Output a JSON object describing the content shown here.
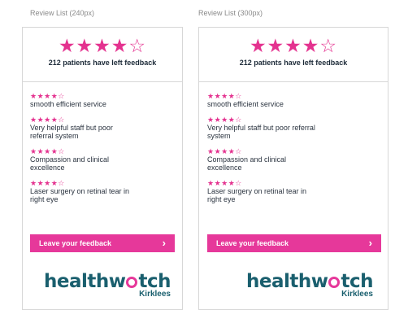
{
  "columns": [
    {
      "label": "Review List (240px)",
      "rating_stars": "★★★★☆",
      "feedback_count": "212 patients have left feedback",
      "reviews": [
        {
          "stars": "★★★★☆",
          "text": "smooth efficient service"
        },
        {
          "stars": "★★★★☆",
          "text": "Very helpful staff but poor referral system"
        },
        {
          "stars": "★★★★☆",
          "text": "Compassion and clinical excellence"
        },
        {
          "stars": "★★★★☆",
          "text": "Laser surgery on retinal tear in right eye"
        }
      ],
      "cta_label": "Leave your feedback",
      "cta_chevron": "›",
      "logo_main_a": "h",
      "logo_main_b": "ealthw",
      "logo_main_c": "tch",
      "logo_sub": "Kirklees"
    },
    {
      "label": "Review List (300px)",
      "rating_stars": "★★★★☆",
      "feedback_count": "212 patients have left feedback",
      "reviews": [
        {
          "stars": "★★★★☆",
          "text": "smooth efficient service"
        },
        {
          "stars": "★★★★☆",
          "text": "Very helpful staff but poor referral system"
        },
        {
          "stars": "★★★★☆",
          "text": "Compassion and clinical excellence"
        },
        {
          "stars": "★★★★☆",
          "text": "Laser surgery on retinal tear in right eye"
        }
      ],
      "cta_label": "Leave your feedback",
      "cta_chevron": "›",
      "logo_main_a": "h",
      "logo_main_b": "ealthw",
      "logo_main_c": "tch",
      "logo_sub": "Kirklees"
    }
  ],
  "colors": {
    "accent": "#e6389a",
    "brand": "#1a5f6e",
    "border": "#d7d7d7"
  },
  "icons": {
    "star": "star-icon",
    "chevron": "chevron-right-icon"
  }
}
